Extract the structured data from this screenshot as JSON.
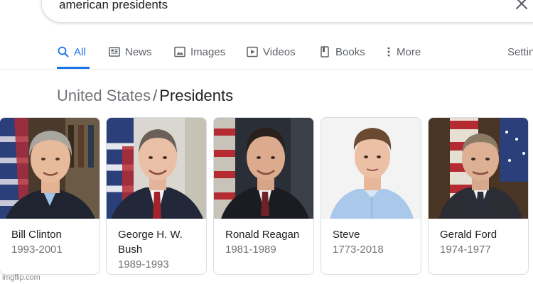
{
  "search": {
    "query": "american presidents"
  },
  "tabs": [
    {
      "label": "All",
      "icon": "search-icon",
      "active": true
    },
    {
      "label": "News",
      "icon": "news-icon"
    },
    {
      "label": "Images",
      "icon": "image-icon"
    },
    {
      "label": "Videos",
      "icon": "play-icon"
    },
    {
      "label": "Books",
      "icon": "book-icon"
    },
    {
      "label": "More",
      "icon": "more-vert-icon"
    },
    {
      "label": "Settings"
    }
  ],
  "breadcrumb": {
    "parent": "United States",
    "separator": "/",
    "current": "Presidents"
  },
  "cards": [
    {
      "name": "Bill Clinton",
      "years": "1993-2001"
    },
    {
      "name": "George H. W. Bush",
      "years": "1989-1993"
    },
    {
      "name": "Ronald Reagan",
      "years": "1981-1989"
    },
    {
      "name": "Steve",
      "years": "1773-2018"
    },
    {
      "name": "Gerald Ford",
      "years": "1974-1977"
    }
  ],
  "watermark": "imgflip.com",
  "colors": {
    "accent": "#1a73e8",
    "text_primary": "#202124",
    "text_secondary": "#70757a",
    "tab_text": "#5f6368",
    "card_border": "#dadce0"
  }
}
